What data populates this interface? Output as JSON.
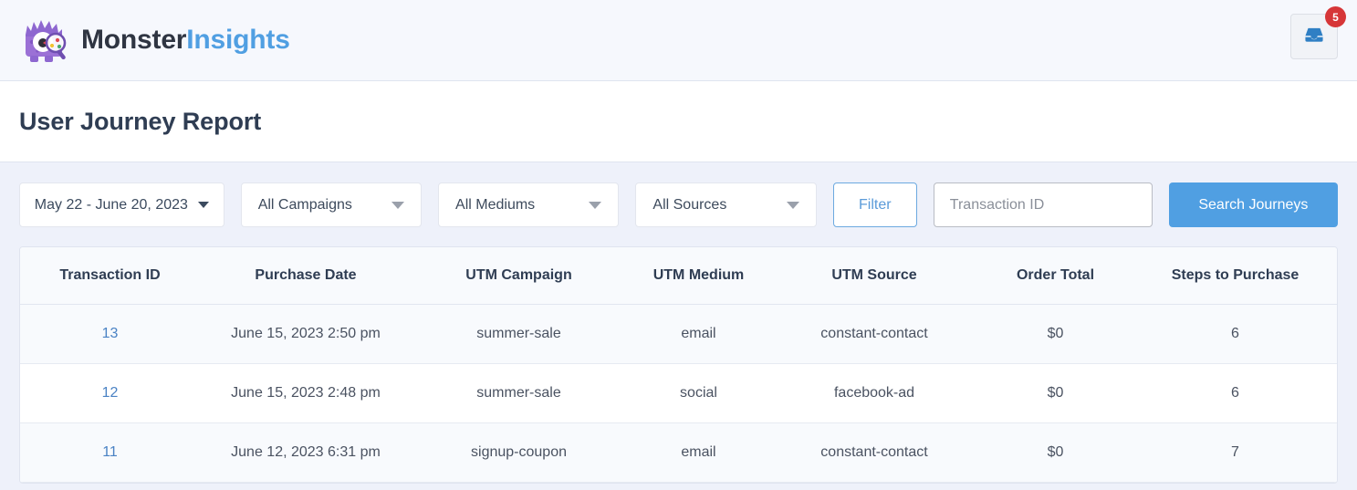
{
  "header": {
    "brand_monster": "Monster",
    "brand_insights": "Insights",
    "brand_mark_icon": "monster-magnifier-logo",
    "inbox_icon": "inbox-tray-icon",
    "inbox_badge_count": "5"
  },
  "page": {
    "title": "User Journey Report"
  },
  "toolbar": {
    "date_range": "May 22 - June 20, 2023",
    "date_caret_icon": "chevron-down-icon",
    "campaigns_label": "All Campaigns",
    "mediums_label": "All Mediums",
    "sources_label": "All Sources",
    "select_caret_icon": "chevron-down-icon",
    "filter_label": "Filter",
    "search_placeholder": "Transaction ID",
    "search_value": "",
    "search_button_label": "Search Journeys"
  },
  "table": {
    "columns": [
      "Transaction ID",
      "Purchase Date",
      "UTM Campaign",
      "UTM Medium",
      "UTM Source",
      "Order Total",
      "Steps to Purchase"
    ],
    "rows": [
      {
        "transaction_id": "13",
        "purchase_date": "June 15, 2023 2:50 pm",
        "utm_campaign": "summer-sale",
        "utm_medium": "email",
        "utm_source": "constant-contact",
        "order_total": "$0",
        "steps_to_purchase": "6"
      },
      {
        "transaction_id": "12",
        "purchase_date": "June 15, 2023 2:48 pm",
        "utm_campaign": "summer-sale",
        "utm_medium": "social",
        "utm_source": "facebook-ad",
        "order_total": "$0",
        "steps_to_purchase": "6"
      },
      {
        "transaction_id": "11",
        "purchase_date": "June 12, 2023 6:31 pm",
        "utm_campaign": "signup-coupon",
        "utm_medium": "email",
        "utm_source": "constant-contact",
        "order_total": "$0",
        "steps_to_purchase": "7"
      }
    ]
  },
  "colors": {
    "accent_blue": "#509fe2",
    "link_blue": "#4a82c4",
    "badge_red": "#d63638",
    "brand_purple": "#9b71d6",
    "page_bg": "#eef1fa"
  }
}
